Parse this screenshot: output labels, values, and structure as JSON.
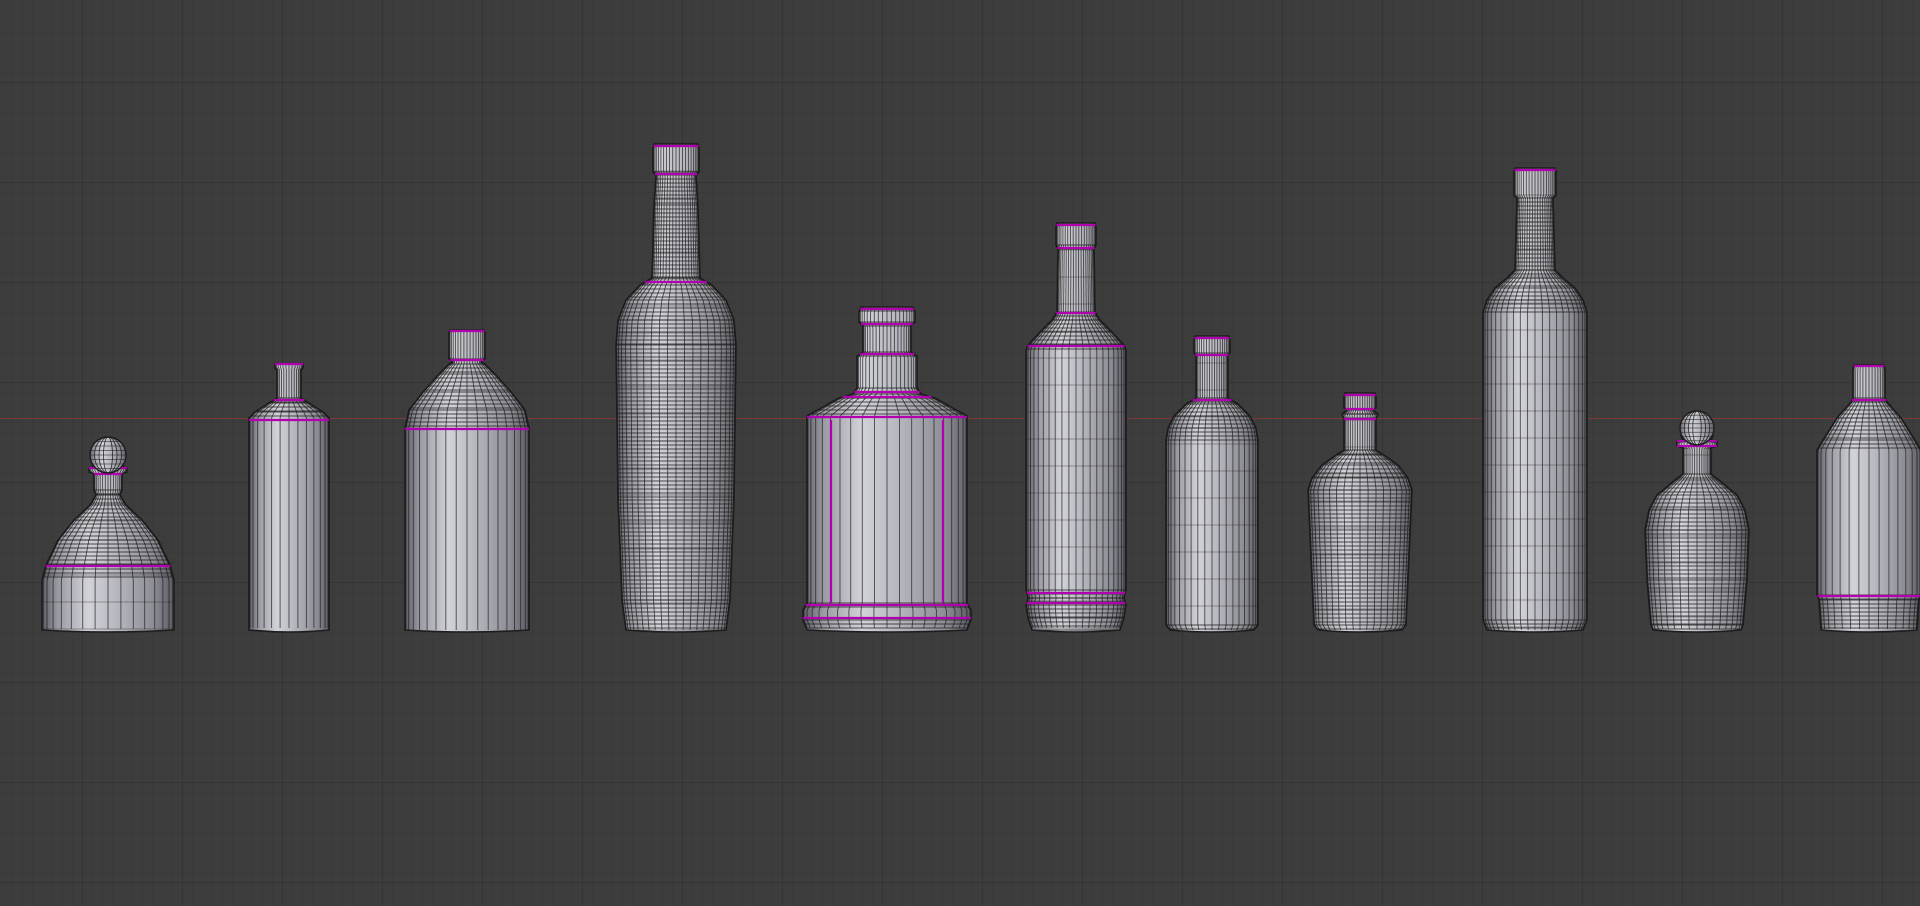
{
  "viewport": {
    "background_color": "#3d3d3d",
    "grid_line_color": "#333333",
    "x_axis_color": "#8a3a3a"
  },
  "materials": {
    "body_light": "#cfcfd6",
    "body_mid": "#a4a4ac",
    "body_dark": "#5a5a62",
    "wire_color": "#1c1c1c",
    "seam_color": "#b000b0"
  },
  "objects": [
    {
      "name": "bottle-decanter-round-stopper"
    },
    {
      "name": "bottle-small-slim"
    },
    {
      "name": "bottle-wide-short-neck"
    },
    {
      "name": "bottle-wine-tall"
    },
    {
      "name": "bottle-square-flask"
    },
    {
      "name": "bottle-vodka-ring-base"
    },
    {
      "name": "bottle-medium-cylindrical"
    },
    {
      "name": "bottle-small-tapered"
    },
    {
      "name": "bottle-tall-cylindrical"
    },
    {
      "name": "bottle-small-decanter-stopper"
    },
    {
      "name": "bottle-angular-shoulder"
    }
  ]
}
